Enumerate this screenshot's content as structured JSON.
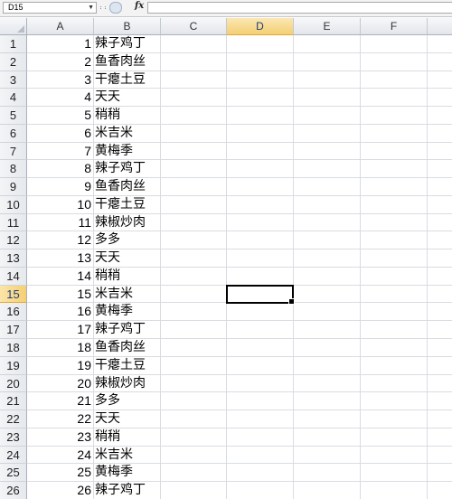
{
  "formula_bar": {
    "name_box": "D15",
    "fx_label": "fx",
    "formula": ""
  },
  "columns": [
    {
      "label": "A",
      "width": 74
    },
    {
      "label": "B",
      "width": 74
    },
    {
      "label": "C",
      "width": 73
    },
    {
      "label": "D",
      "width": 74,
      "selected": true
    },
    {
      "label": "E",
      "width": 74
    },
    {
      "label": "F",
      "width": 74
    },
    {
      "label": "",
      "width": 40
    }
  ],
  "active_cell": {
    "row": 15,
    "col": 3
  },
  "rows": [
    {
      "header": "1",
      "a": "1",
      "b": "辣子鸡丁"
    },
    {
      "header": "2",
      "a": "2",
      "b": "鱼香肉丝"
    },
    {
      "header": "3",
      "a": "3",
      "b": "干瘪土豆"
    },
    {
      "header": "4",
      "a": "4",
      "b": "天天"
    },
    {
      "header": "5",
      "a": "5",
      "b": "稍稍"
    },
    {
      "header": "6",
      "a": "6",
      "b": "米吉米"
    },
    {
      "header": "7",
      "a": "7",
      "b": "黄梅季"
    },
    {
      "header": "8",
      "a": "8",
      "b": "辣子鸡丁"
    },
    {
      "header": "9",
      "a": "9",
      "b": "鱼香肉丝"
    },
    {
      "header": "10",
      "a": "10",
      "b": "干瘪土豆"
    },
    {
      "header": "11",
      "a": "11",
      "b": "辣椒炒肉"
    },
    {
      "header": "12",
      "a": "12",
      "b": "多多"
    },
    {
      "header": "13",
      "a": "13",
      "b": "天天"
    },
    {
      "header": "14",
      "a": "14",
      "b": "稍稍"
    },
    {
      "header": "15",
      "a": "15",
      "b": "米吉米"
    },
    {
      "header": "16",
      "a": "16",
      "b": "黄梅季"
    },
    {
      "header": "17",
      "a": "17",
      "b": "辣子鸡丁"
    },
    {
      "header": "18",
      "a": "18",
      "b": "鱼香肉丝"
    },
    {
      "header": "19",
      "a": "19",
      "b": "干瘪土豆"
    },
    {
      "header": "20",
      "a": "20",
      "b": "辣椒炒肉"
    },
    {
      "header": "21",
      "a": "21",
      "b": "多多"
    },
    {
      "header": "22",
      "a": "22",
      "b": "天天"
    },
    {
      "header": "23",
      "a": "23",
      "b": "稍稍"
    },
    {
      "header": "24",
      "a": "24",
      "b": "米吉米"
    },
    {
      "header": "25",
      "a": "25",
      "b": "黄梅季"
    },
    {
      "header": "26",
      "a": "26",
      "b": "辣子鸡丁"
    }
  ]
}
